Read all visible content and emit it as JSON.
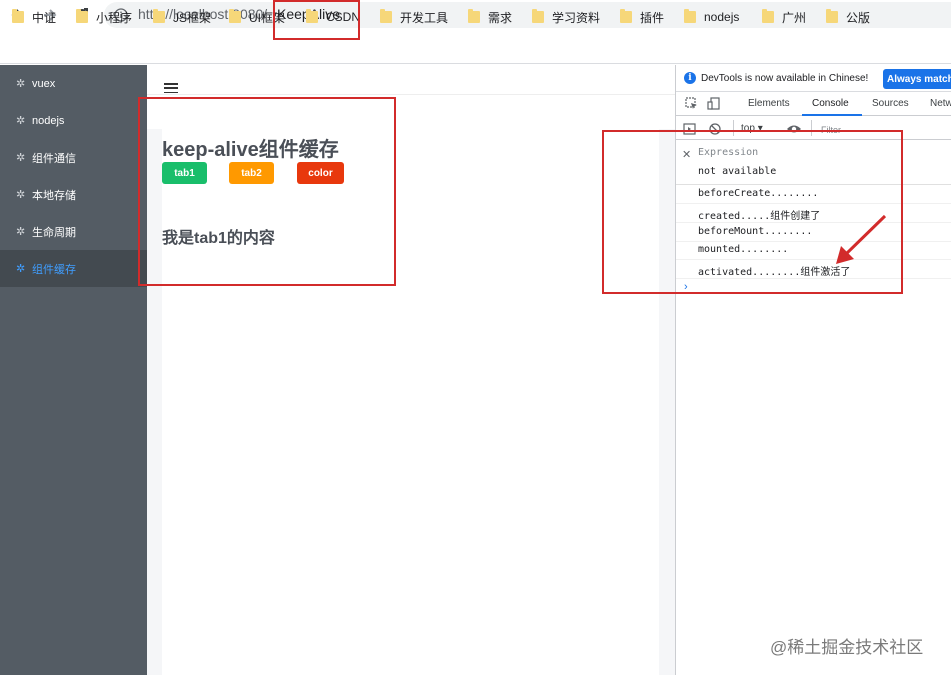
{
  "browser": {
    "url_host": "http://localhost:8080/",
    "url_path": "KeepAlive",
    "bookmarks": [
      "中证",
      "小程序",
      "JS框架",
      "UI框架",
      "CSDN",
      "开发工具",
      "需求",
      "学习资料",
      "插件",
      "nodejs",
      "广州",
      "公版"
    ]
  },
  "sidebar": {
    "items": [
      {
        "label": "vuex"
      },
      {
        "label": "nodejs"
      },
      {
        "label": "组件通信"
      },
      {
        "label": "本地存储"
      },
      {
        "label": "生命周期"
      },
      {
        "label": "组件缓存"
      }
    ],
    "active_index": 5
  },
  "main": {
    "title": "keep-alive组件缓存",
    "buttons": [
      {
        "label": "tab1",
        "color": "#19be6b"
      },
      {
        "label": "tab2",
        "color": "#ff9900"
      },
      {
        "label": "color",
        "color": "#e8380d"
      }
    ],
    "tab_content": "我是tab1的内容"
  },
  "devtools": {
    "notice": "DevTools is now available in Chinese!",
    "notice_button": "Always match",
    "tabs": [
      "Elements",
      "Console",
      "Sources",
      "Netw"
    ],
    "active_tab": "Console",
    "context": "top",
    "filter_placeholder": "Filter",
    "expression": {
      "label": "Expression",
      "value": "not available"
    },
    "logs": [
      "beforeCreate........",
      "created.....组件创建了",
      "beforeMount........",
      "mounted........",
      "activated........组件激活了"
    ]
  },
  "watermark": "@稀土掘金技术社区",
  "colors": {
    "accent": "#409eff",
    "sidebar_bg": "#545c64",
    "annotation": "#d22b2b"
  }
}
